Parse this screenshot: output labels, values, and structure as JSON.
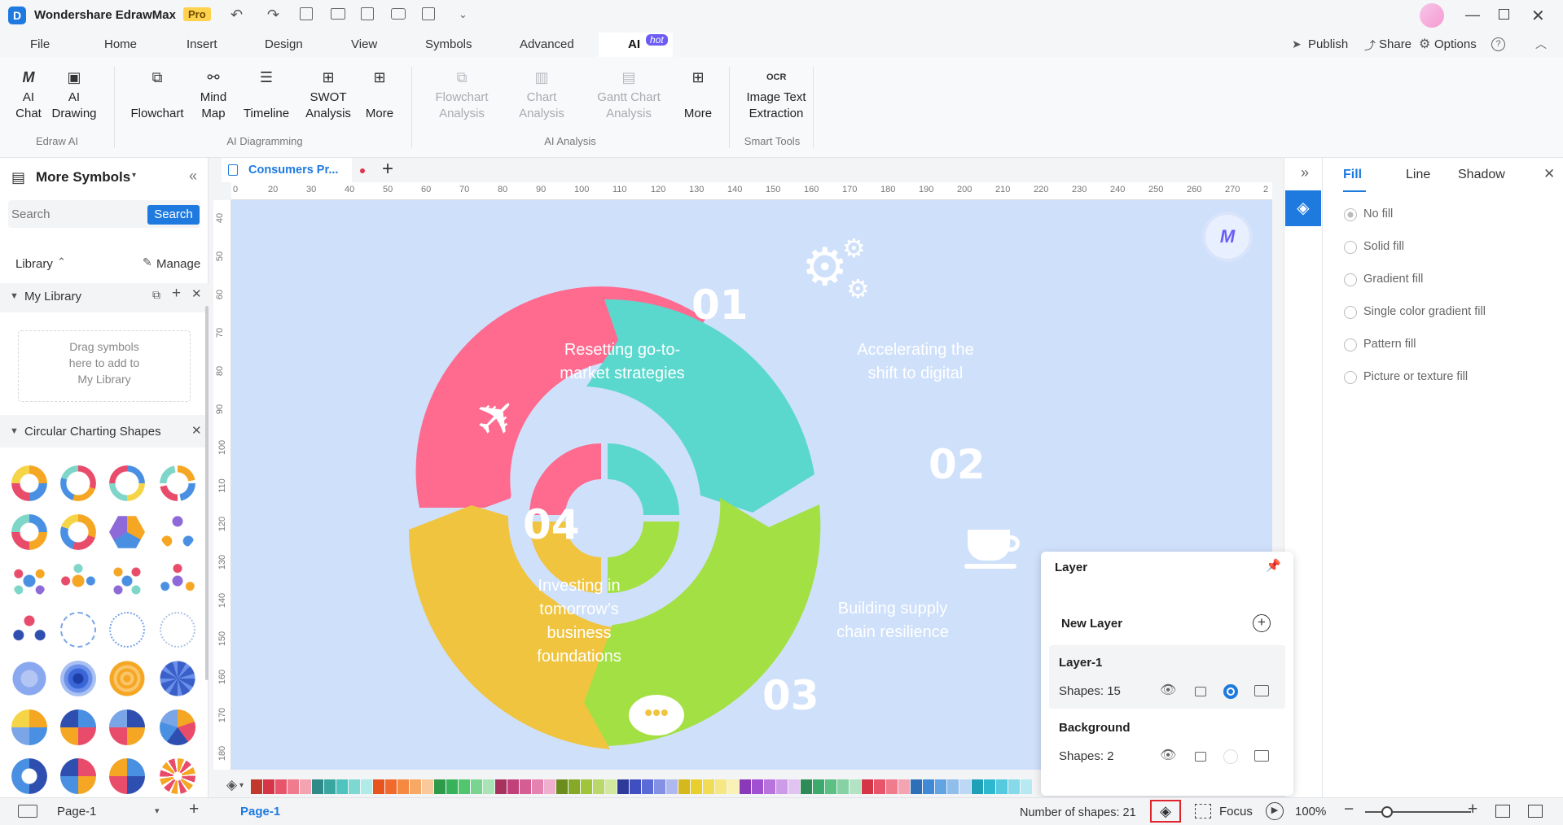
{
  "app": {
    "title": "Wondershare EdrawMax",
    "badge": "Pro"
  },
  "menu": {
    "items": [
      "File",
      "Home",
      "Insert",
      "Design",
      "View",
      "Symbols",
      "Advanced",
      "AI"
    ],
    "ai_badge": "hot",
    "publish": "Publish",
    "share": "Share",
    "options": "Options"
  },
  "ribbon": {
    "edraw_ai": {
      "label": "Edraw AI",
      "buttons": [
        "AI Chat",
        "AI Drawing"
      ],
      "ai_chat_1": "AI",
      "ai_chat_2": "Chat",
      "ai_drawing_1": "AI",
      "ai_drawing_2": "Drawing"
    },
    "diagramming": {
      "label": "AI Diagramming",
      "flowchart": "Flowchart",
      "mind_1": "Mind",
      "mind_2": "Map",
      "timeline": "Timeline",
      "swot_1": "SWOT",
      "swot_2": "Analysis",
      "more": "More"
    },
    "analysis": {
      "label": "AI Analysis",
      "flow_1": "Flowchart",
      "flow_2": "Analysis",
      "chart_1": "Chart",
      "chart_2": "Analysis",
      "gantt_1": "Gantt Chart",
      "gantt_2": "Analysis",
      "more": "More"
    },
    "smart": {
      "label": "Smart Tools",
      "ocr_1": "Image Text",
      "ocr_2": "Extraction",
      "ocr_icon": "OCR"
    }
  },
  "left": {
    "title": "More Symbols",
    "search_placeholder": "Search",
    "search_button": "Search",
    "library": "Library",
    "manage": "Manage",
    "my_library": "My Library",
    "drop_hint_1": "Drag symbols",
    "drop_hint_2": "here to add to",
    "drop_hint_3": "My Library",
    "category": "Circular Charting Shapes"
  },
  "tab": {
    "name": "Consumers Pr..."
  },
  "ruler": {
    "h": [
      "0",
      "20",
      "30",
      "40",
      "50",
      "60",
      "70",
      "80",
      "90",
      "100",
      "110",
      "120",
      "130",
      "140",
      "150",
      "160",
      "170",
      "180",
      "190",
      "200",
      "210",
      "220",
      "230",
      "240",
      "250",
      "260",
      "270",
      "2"
    ],
    "v": [
      "40",
      "50",
      "60",
      "70",
      "80",
      "90",
      "100",
      "110",
      "120",
      "130",
      "140",
      "150",
      "160",
      "170",
      "180"
    ]
  },
  "diagram": {
    "seg1": {
      "num": "01",
      "line1": "Resetting go-to-",
      "line2": "market strategies",
      "color": "#ff6a8f"
    },
    "seg2": {
      "num": "02",
      "line1": "Accelerating the",
      "line2": "shift to digital",
      "color": "#5ad8cd"
    },
    "seg3": {
      "num": "03",
      "line1": "Building supply",
      "line2": "chain resilience",
      "color": "#a3e043"
    },
    "seg4": {
      "num": "04",
      "line1": "Investing in",
      "line2": "tomorrow’s",
      "line3": "business",
      "line4": "foundations",
      "color": "#f0c43e"
    }
  },
  "rightpanel": {
    "tabs": [
      "Fill",
      "Line",
      "Shadow"
    ],
    "options": [
      "No fill",
      "Solid fill",
      "Gradient fill",
      "Single color gradient fill",
      "Pattern fill",
      "Picture or texture fill"
    ]
  },
  "layer": {
    "title": "Layer",
    "new_layer": "New Layer",
    "layers": [
      {
        "name": "Layer-1",
        "shapes": "Shapes: 15"
      },
      {
        "name": "Background",
        "shapes": "Shapes: 2"
      }
    ]
  },
  "status": {
    "page_select": "Page-1",
    "page_tab": "Page-1",
    "shape_count": "Number of shapes: 21",
    "focus": "Focus",
    "zoom": "100%"
  },
  "palette": [
    "#c0392b",
    "#d63447",
    "#e8546a",
    "#f07b8c",
    "#f4a3b0",
    "#2e8b87",
    "#3aa6a0",
    "#4fc3bd",
    "#7dd8d2",
    "#b0ebe7",
    "#e8541e",
    "#f06a2e",
    "#f4893f",
    "#f7a865",
    "#f9c99b",
    "#2e9a4a",
    "#38b25a",
    "#52c66f",
    "#79d48f",
    "#a8e4b6",
    "#a8325e",
    "#c2407a",
    "#d65d94",
    "#e483b0",
    "#efb0cf",
    "#6d8c1e",
    "#86a928",
    "#a0c43a",
    "#bad86a",
    "#d3e89f",
    "#2e3a9a",
    "#3f4fc0",
    "#5a6ad6",
    "#8390e3",
    "#b0b9ef",
    "#d4b81e",
    "#e8cf2e",
    "#f0dc55",
    "#f5e784",
    "#f9f1b5",
    "#8a3ab8",
    "#a050d0",
    "#b874dc",
    "#cd9be7",
    "#e1c3f1",
    "#2e8b57",
    "#3caa6c",
    "#5cc085",
    "#86d2a4",
    "#b3e3c5",
    "#d63447",
    "#e8546a",
    "#f07b8c",
    "#f4a3b0",
    "#2e6fb8",
    "#3f89d6",
    "#62a3e3",
    "#8fbdec",
    "#bcd8f4",
    "#1ea0b8",
    "#2eb8d0",
    "#55c9de",
    "#86d9e8",
    "#b6e9f2"
  ]
}
